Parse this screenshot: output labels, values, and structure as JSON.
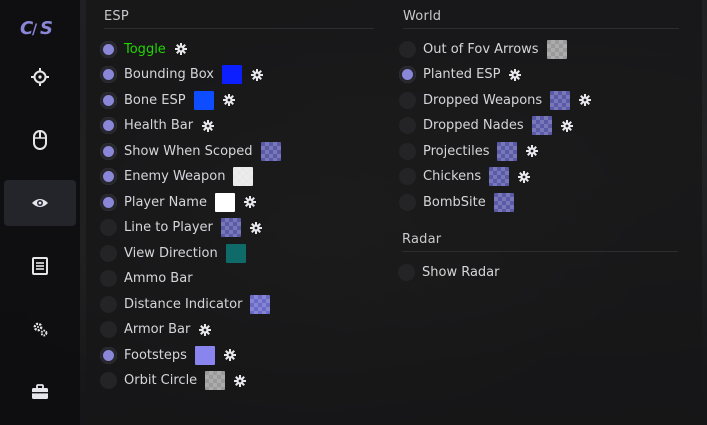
{
  "app": {
    "logo_text": "CS",
    "nav": [
      {
        "icon": "crosshair-icon",
        "label": "aimbot",
        "active": false
      },
      {
        "icon": "mouse-icon",
        "label": "triggerbot",
        "active": false
      },
      {
        "icon": "eye-icon",
        "label": "visuals",
        "active": true
      },
      {
        "icon": "document-icon",
        "label": "misc",
        "active": false
      },
      {
        "icon": "gears-icon",
        "label": "settings",
        "active": false
      },
      {
        "icon": "briefcase-icon",
        "label": "inventory",
        "active": false
      }
    ]
  },
  "esp": {
    "title": "ESP",
    "items": [
      {
        "label": "Toggle",
        "on": true,
        "swatch": null,
        "gear": true
      },
      {
        "label": "Bounding Box",
        "on": true,
        "swatch": "#0b1fff",
        "gear": true
      },
      {
        "label": "Bone ESP",
        "on": true,
        "swatch": "#0d4dff",
        "gear": true
      },
      {
        "label": "Health Bar",
        "on": true,
        "swatch": null,
        "gear": true
      },
      {
        "label": "Show When Scoped",
        "on": true,
        "swatch": "#5a5aa8-checker",
        "gear": false
      },
      {
        "label": "Enemy Weapon",
        "on": true,
        "swatch": "#e8e8e8-checker",
        "gear": false
      },
      {
        "label": "Player Name",
        "on": true,
        "swatch": "#ffffff",
        "gear": true
      },
      {
        "label": "Line to Player",
        "on": false,
        "swatch": "#5a5aa8-checker",
        "gear": true
      },
      {
        "label": "View Direction",
        "on": false,
        "swatch": "#0f6a6a",
        "gear": false
      },
      {
        "label": "Ammo Bar",
        "on": false,
        "swatch": null,
        "gear": false
      },
      {
        "label": "Distance Indicator",
        "on": false,
        "swatch": "#6a6ac8-checker",
        "gear": false
      },
      {
        "label": "Armor Bar",
        "on": false,
        "swatch": null,
        "gear": true
      },
      {
        "label": "Footsteps",
        "on": true,
        "swatch": "#8a84ee",
        "gear": true
      },
      {
        "label": "Orbit Circle",
        "on": false,
        "swatch": "#9a9a9a-checker",
        "gear": true
      }
    ]
  },
  "world": {
    "title": "World",
    "items": [
      {
        "label": "Out of Fov Arrows",
        "on": false,
        "swatch": "#9a9a9a-checker",
        "gear": false
      },
      {
        "label": "Planted ESP",
        "on": true,
        "swatch": null,
        "gear": true
      },
      {
        "label": "Dropped Weapons",
        "on": false,
        "swatch": "#5a5aa8-checker",
        "gear": true
      },
      {
        "label": "Dropped Nades",
        "on": false,
        "swatch": "#5a5aa8-checker",
        "gear": true
      },
      {
        "label": "Projectiles",
        "on": false,
        "swatch": "#5a5aa8-checker",
        "gear": true
      },
      {
        "label": "Chickens",
        "on": false,
        "swatch": "#5a5aa8-checker",
        "gear": true
      },
      {
        "label": "BombSite",
        "on": false,
        "swatch": "#5a5aa8-checker",
        "gear": false
      }
    ]
  },
  "radar": {
    "title": "Radar",
    "items": [
      {
        "label": "Show Radar",
        "on": false,
        "swatch": null,
        "gear": false
      }
    ]
  },
  "colors": {
    "accent": "#8a86d8",
    "highlight_text": "#22d400"
  }
}
